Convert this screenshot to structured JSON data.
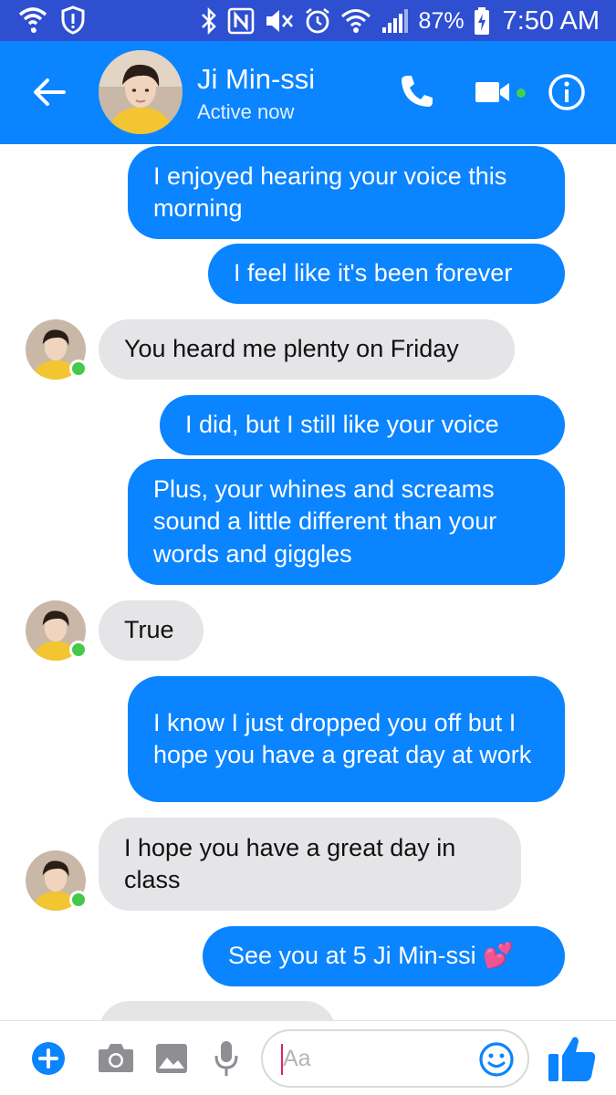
{
  "status_bar": {
    "battery_percent": "87%",
    "time": "7:50 AM"
  },
  "header": {
    "contact_name": "Ji Min-ssi",
    "presence": "Active now"
  },
  "messages": [
    {
      "sender": "me",
      "text": "I enjoyed hearing your voice this morning"
    },
    {
      "sender": "me",
      "text": "I feel like it's been forever"
    },
    {
      "sender": "contact",
      "text": "You heard me plenty on Friday"
    },
    {
      "sender": "me",
      "text": "I did,  but I still like your voice"
    },
    {
      "sender": "me",
      "text": "Plus, your whines and screams sound a little different than your words and giggles"
    },
    {
      "sender": "contact",
      "text": "True"
    },
    {
      "sender": "me",
      "text": "I know I just dropped you off but I hope you have a great day at work"
    },
    {
      "sender": "contact",
      "text": "I hope you have a great day in class"
    },
    {
      "sender": "me",
      "text": "See you at 5 Ji Min-ssi 💕"
    }
  ],
  "composer": {
    "placeholder": "Aa"
  },
  "colors": {
    "status_bar": "#2f4fd1",
    "header": "#0a84ff",
    "outgoing_bubble": "#0a84ff",
    "incoming_bubble": "#e5e5e8",
    "online": "#44c94b"
  },
  "icons": {
    "status_bar": [
      "wifi-call-icon",
      "alert-shield-icon",
      "bluetooth-icon",
      "nfc-icon",
      "mute-icon",
      "alarm-icon",
      "wifi-icon",
      "signal-icon",
      "battery-charging-icon"
    ],
    "header": [
      "back-arrow-icon",
      "phone-icon",
      "video-icon",
      "info-icon"
    ],
    "composer": [
      "plus-icon",
      "camera-icon",
      "image-icon",
      "microphone-icon",
      "emoji-icon",
      "thumbs-up-icon"
    ]
  }
}
